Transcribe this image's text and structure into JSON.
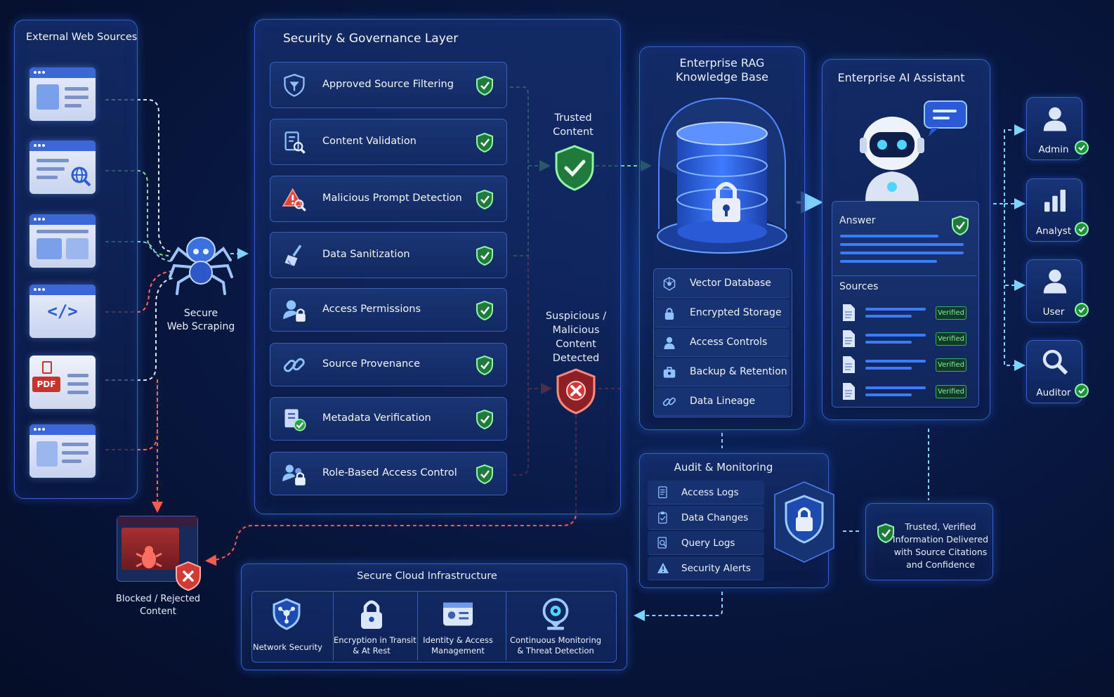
{
  "external_sources": {
    "title": "External Web Sources",
    "pdf_label": "PDF"
  },
  "scraping": {
    "label_line1": "Secure",
    "label_line2": "Web Scraping"
  },
  "governance": {
    "title": "Security & Governance Layer",
    "items": [
      {
        "label": "Approved Source Filtering",
        "icon": "filter-shield-icon"
      },
      {
        "label": "Content Validation",
        "icon": "document-search-icon"
      },
      {
        "label": "Malicious Prompt Detection",
        "icon": "warning-search-icon"
      },
      {
        "label": "Data Sanitization",
        "icon": "broom-icon"
      },
      {
        "label": "Access Permissions",
        "icon": "user-lock-icon"
      },
      {
        "label": "Source Provenance",
        "icon": "link-icon"
      },
      {
        "label": "Metadata Verification",
        "icon": "document-check-icon"
      },
      {
        "label": "Role-Based Access Control",
        "icon": "users-lock-icon"
      }
    ]
  },
  "trusted": {
    "line1": "Trusted",
    "line2": "Content"
  },
  "suspicious": {
    "line1": "Suspicious /",
    "line2": "Malicious",
    "line3": "Content",
    "line4": "Detected"
  },
  "blocked": {
    "line1": "Blocked / Rejected",
    "line2": "Content"
  },
  "knowledge_base": {
    "title_line1": "Enterprise RAG",
    "title_line2": "Knowledge Base",
    "items": [
      {
        "label": "Vector Database",
        "icon": "vector-icon"
      },
      {
        "label": "Encrypted Storage",
        "icon": "lock-icon"
      },
      {
        "label": "Access Controls",
        "icon": "user-icon"
      },
      {
        "label": "Backup & Retention",
        "icon": "briefcase-icon"
      },
      {
        "label": "Data Lineage",
        "icon": "link-icon"
      }
    ]
  },
  "assistant": {
    "title": "Enterprise AI Assistant",
    "answer_label": "Answer",
    "sources_label": "Sources",
    "verified_label": "Verified"
  },
  "users": [
    {
      "label": "Admin",
      "icon": "person-icon"
    },
    {
      "label": "Analyst",
      "icon": "bar-chart-icon"
    },
    {
      "label": "User",
      "icon": "person-icon"
    },
    {
      "label": "Auditor",
      "icon": "magnifier-icon"
    }
  ],
  "audit": {
    "title": "Audit & Monitoring",
    "items": [
      {
        "label": "Access Logs",
        "icon": "log-icon"
      },
      {
        "label": "Data Changes",
        "icon": "clipboard-icon"
      },
      {
        "label": "Query Logs",
        "icon": "search-doc-icon"
      },
      {
        "label": "Security Alerts",
        "icon": "alert-icon"
      }
    ]
  },
  "delivered": {
    "line1": "Trusted, Verified",
    "line2": "Information Delivered",
    "line3": "with Source Citations",
    "line4": "and Confidence"
  },
  "cloud": {
    "title": "Secure Cloud Infrastructure",
    "items": [
      {
        "line1": "Network Security",
        "line2": "",
        "icon": "network-shield-icon"
      },
      {
        "line1": "Encryption in Transit",
        "line2": "& At Rest",
        "icon": "padlock-icon"
      },
      {
        "line1": "Identity & Access",
        "line2": "Management",
        "icon": "id-card-icon"
      },
      {
        "line1": "Continuous Monitoring",
        "line2": "& Threat Detection",
        "icon": "monitor-eye-icon"
      }
    ]
  },
  "colors": {
    "trusted_green": "#6fe07f",
    "danger_red": "#ff5a4f",
    "flow_cyan": "#7fd4ff",
    "panel_border": "#3462c9"
  }
}
